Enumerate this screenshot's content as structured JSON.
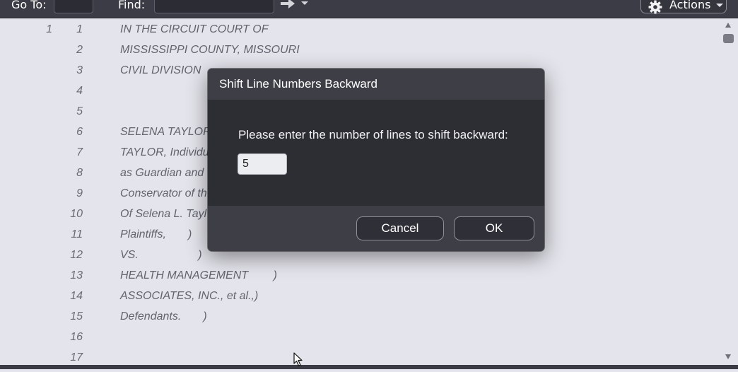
{
  "toolbar": {
    "goto_label": "Go To:",
    "goto_value": "",
    "find_label": "Find:",
    "find_value": "",
    "go_icon": "arrow-right-icon",
    "actions_label": "Actions",
    "actions_icon": "gear-icon"
  },
  "transcript": {
    "page_number": "1",
    "lines": [
      {
        "num": "1",
        "text": "IN THE CIRCUIT COURT OF"
      },
      {
        "num": "2",
        "text": "MISSISSIPPI COUNTY, MISSOURI"
      },
      {
        "num": "3",
        "text": "CIVIL DIVISION"
      },
      {
        "num": "4",
        "text": ""
      },
      {
        "num": "5",
        "text": ""
      },
      {
        "num": "6",
        "text": "SELENA TAYLOR a"
      },
      {
        "num": "7",
        "text": "TAYLOR, Individu"
      },
      {
        "num": "8",
        "text": "as Guardian and"
      },
      {
        "num": "9",
        "text": "Conservator of th"
      },
      {
        "num": "10",
        "text": "Of Selena L. Tayl"
      },
      {
        "num": "11",
        "text": "Plaintiffs,       )"
      },
      {
        "num": "12",
        "text": "VS.                   )"
      },
      {
        "num": "13",
        "text": "HEALTH MANAGEMENT        )"
      },
      {
        "num": "14",
        "text": "ASSOCIATES, INC., et al.,)"
      },
      {
        "num": "15",
        "text": "Defendants.       )"
      },
      {
        "num": "16",
        "text": ""
      },
      {
        "num": "17",
        "text": ""
      }
    ]
  },
  "dialog": {
    "title": "Shift Line Numbers Backward",
    "prompt": "Please enter the number of lines to shift backward:",
    "input_value": "5",
    "cancel_label": "Cancel",
    "ok_label": "OK"
  },
  "colors": {
    "toolbar_bg": "#3b3c45",
    "page_bg": "#e4e5ec",
    "dialog_bg": "#2d2e34",
    "dialog_header_bg": "#3d3e46"
  }
}
